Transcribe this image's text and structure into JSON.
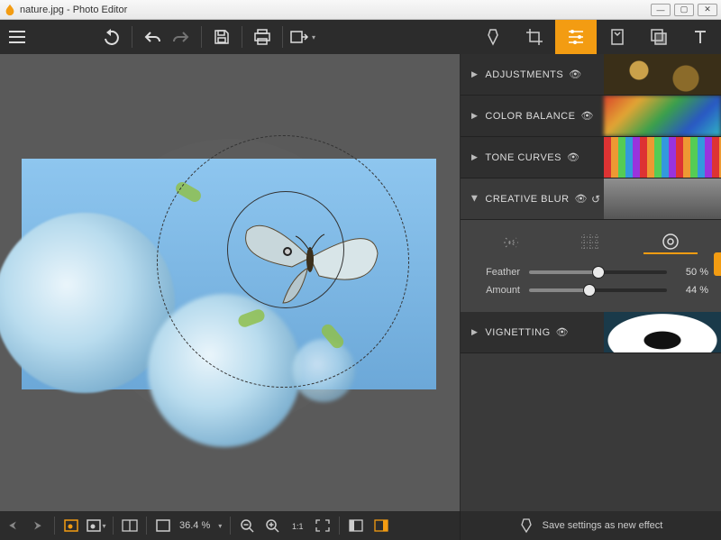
{
  "window": {
    "title": "nature.jpg - Photo Editor"
  },
  "toolbar": {
    "menu": "menu",
    "undo_big": "undo-large",
    "undo": "undo",
    "redo": "redo",
    "save": "save",
    "print": "print",
    "export": "export"
  },
  "modes": {
    "effects": "effects",
    "crop": "crop",
    "adjust": "adjust",
    "presets": "presets",
    "overlay": "overlay",
    "text": "text",
    "active": "adjust"
  },
  "sections": {
    "adjustments": "ADJUSTMENTS",
    "color_balance": "COLOR BALANCE",
    "tone_curves": "TONE CURVES",
    "creative_blur": "CREATIVE BLUR",
    "vignetting": "VIGNETTING"
  },
  "blur_panel": {
    "tabs": [
      "linear",
      "grid",
      "radial"
    ],
    "active_tab": "radial",
    "sliders": {
      "feather": {
        "label": "Feather",
        "value": "50 %",
        "pct": 50
      },
      "amount": {
        "label": "Amount",
        "value": "44 %",
        "pct": 44
      }
    }
  },
  "status": {
    "zoom": "36.4 %",
    "save_effect": "Save settings as new effect"
  }
}
